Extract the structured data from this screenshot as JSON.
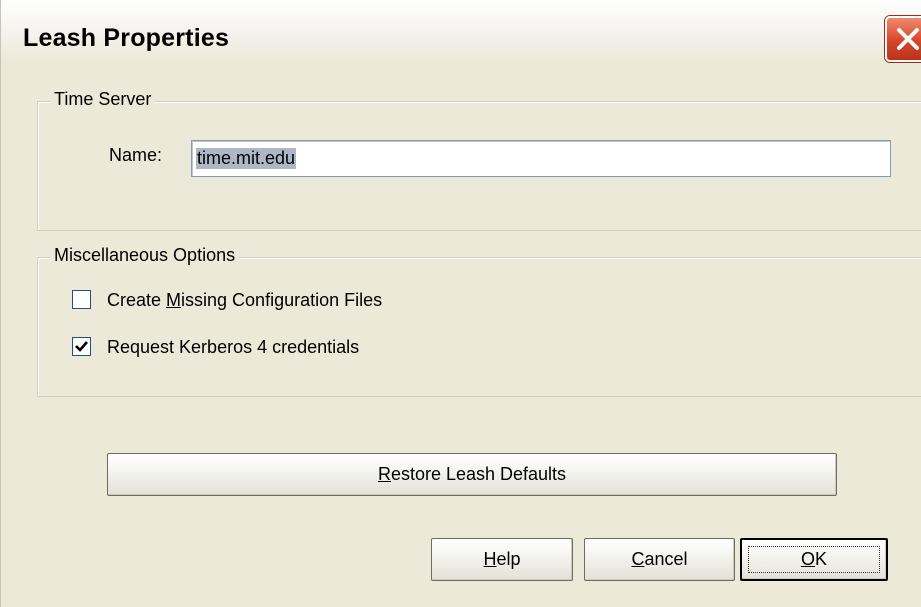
{
  "window": {
    "title": "Leash Properties",
    "close_icon": "close-x-icon"
  },
  "time_server": {
    "legend": "Time Server",
    "name_label": "Name:",
    "name_value": "time.mit.edu"
  },
  "misc_options": {
    "legend": "Miscellaneous Options",
    "options": [
      {
        "pre": "Create ",
        "mnemonic": "M",
        "post": "issing Configuration Files",
        "checked": false
      },
      {
        "pre": "Request Kerberos 4 credentials",
        "mnemonic": "",
        "post": "",
        "checked": true
      }
    ]
  },
  "buttons": {
    "restore": {
      "mnemonic": "R",
      "rest": "estore Leash Defaults"
    },
    "help": {
      "mnemonic": "H",
      "rest": "elp"
    },
    "cancel": {
      "mnemonic": "C",
      "rest": "ancel"
    },
    "ok": {
      "mnemonic": "O",
      "rest": "K"
    }
  },
  "colors": {
    "dialog_bg": "#ece9d8",
    "close_button": "#d5452a",
    "checkbox_border": "#1c5180",
    "input_border": "#7f9db9",
    "selection_highlight": "#aeb7c6"
  }
}
